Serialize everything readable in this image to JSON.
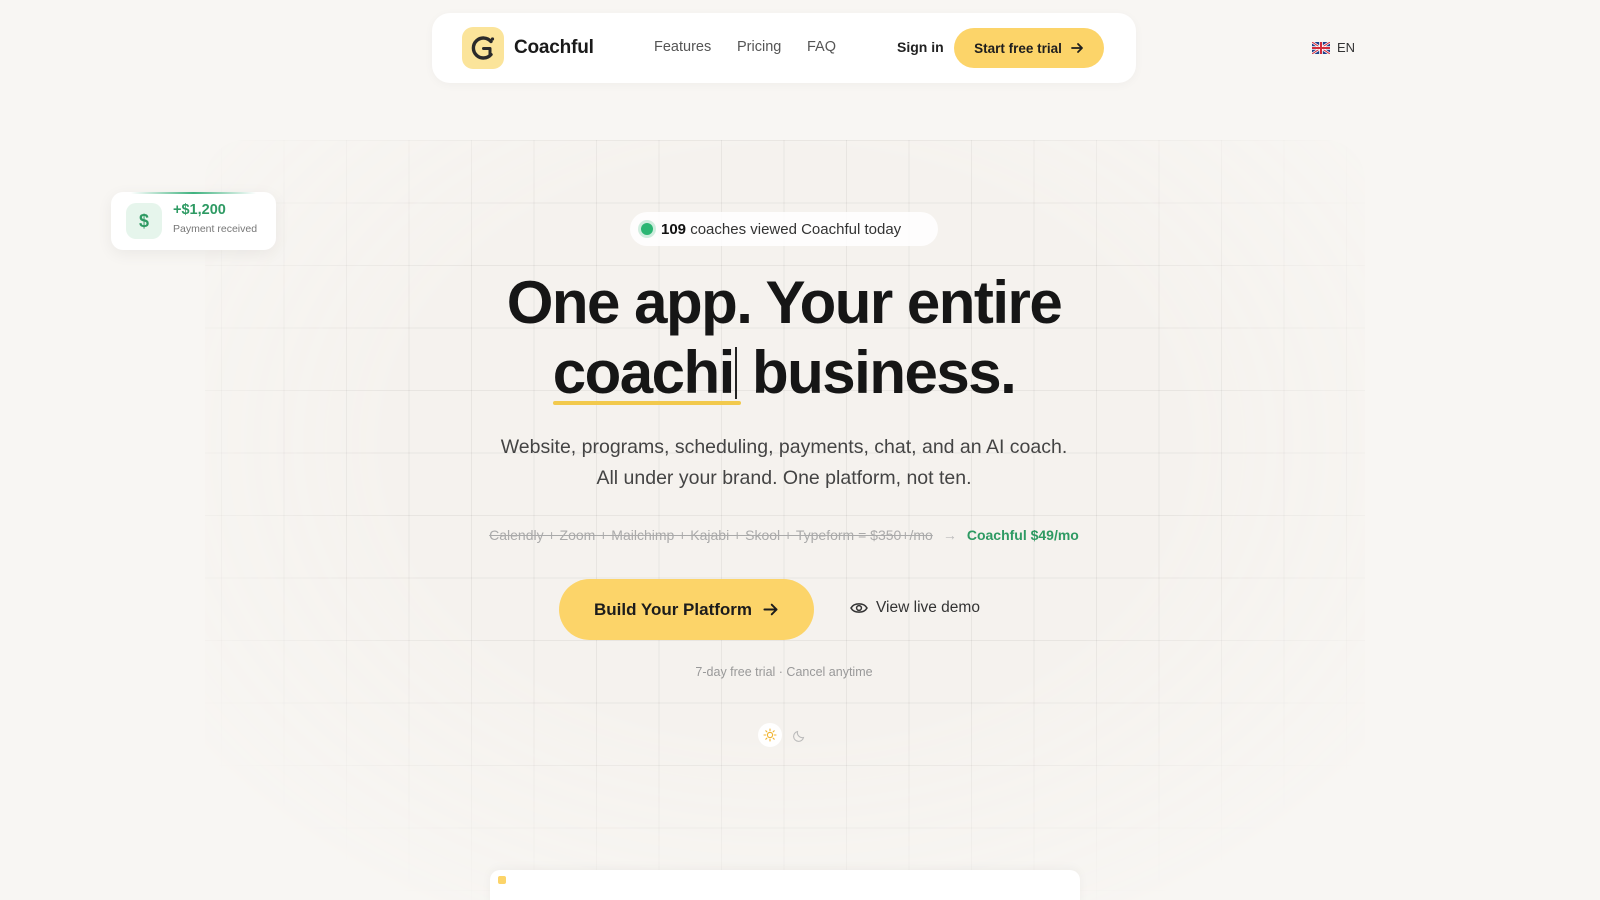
{
  "nav": {
    "brand": "Coachful",
    "logo_letter": "C",
    "links": [
      "Features",
      "Pricing",
      "FAQ"
    ],
    "sign_in": "Sign in",
    "cta": "Start free trial",
    "lang": "EN",
    "lang_icon": "uk-flag-icon"
  },
  "payment_card": {
    "icon": "dollar-icon",
    "symbol": "$",
    "amount": "+$1,200",
    "label": "Payment received"
  },
  "viewers": {
    "count": "109",
    "text": "coaches viewed Coachful today"
  },
  "hero": {
    "line1": "One app. Your entire",
    "typed_word": "coachi",
    "line2_rest": "business.",
    "sub_line1": "Website, programs, scheduling, payments, chat, and an AI coach.",
    "sub_line2": "All under your brand. One platform, not ten.",
    "compare_old": "Calendly + Zoom + Mailchimp + Kajabi + Skool + Typeform = $350+/mo",
    "compare_arrow": "→",
    "compare_new": "Coachful $49/mo",
    "cta_primary": "Build Your Platform",
    "cta_secondary": "View live demo",
    "fine_print": "7-day free trial · Cancel anytime"
  },
  "theme_toggle": {
    "light_icon": "sun-icon",
    "dark_icon": "moon-icon"
  },
  "colors": {
    "accent": "#fcd469",
    "success": "#2e9a63",
    "background": "#f8f6f3"
  }
}
